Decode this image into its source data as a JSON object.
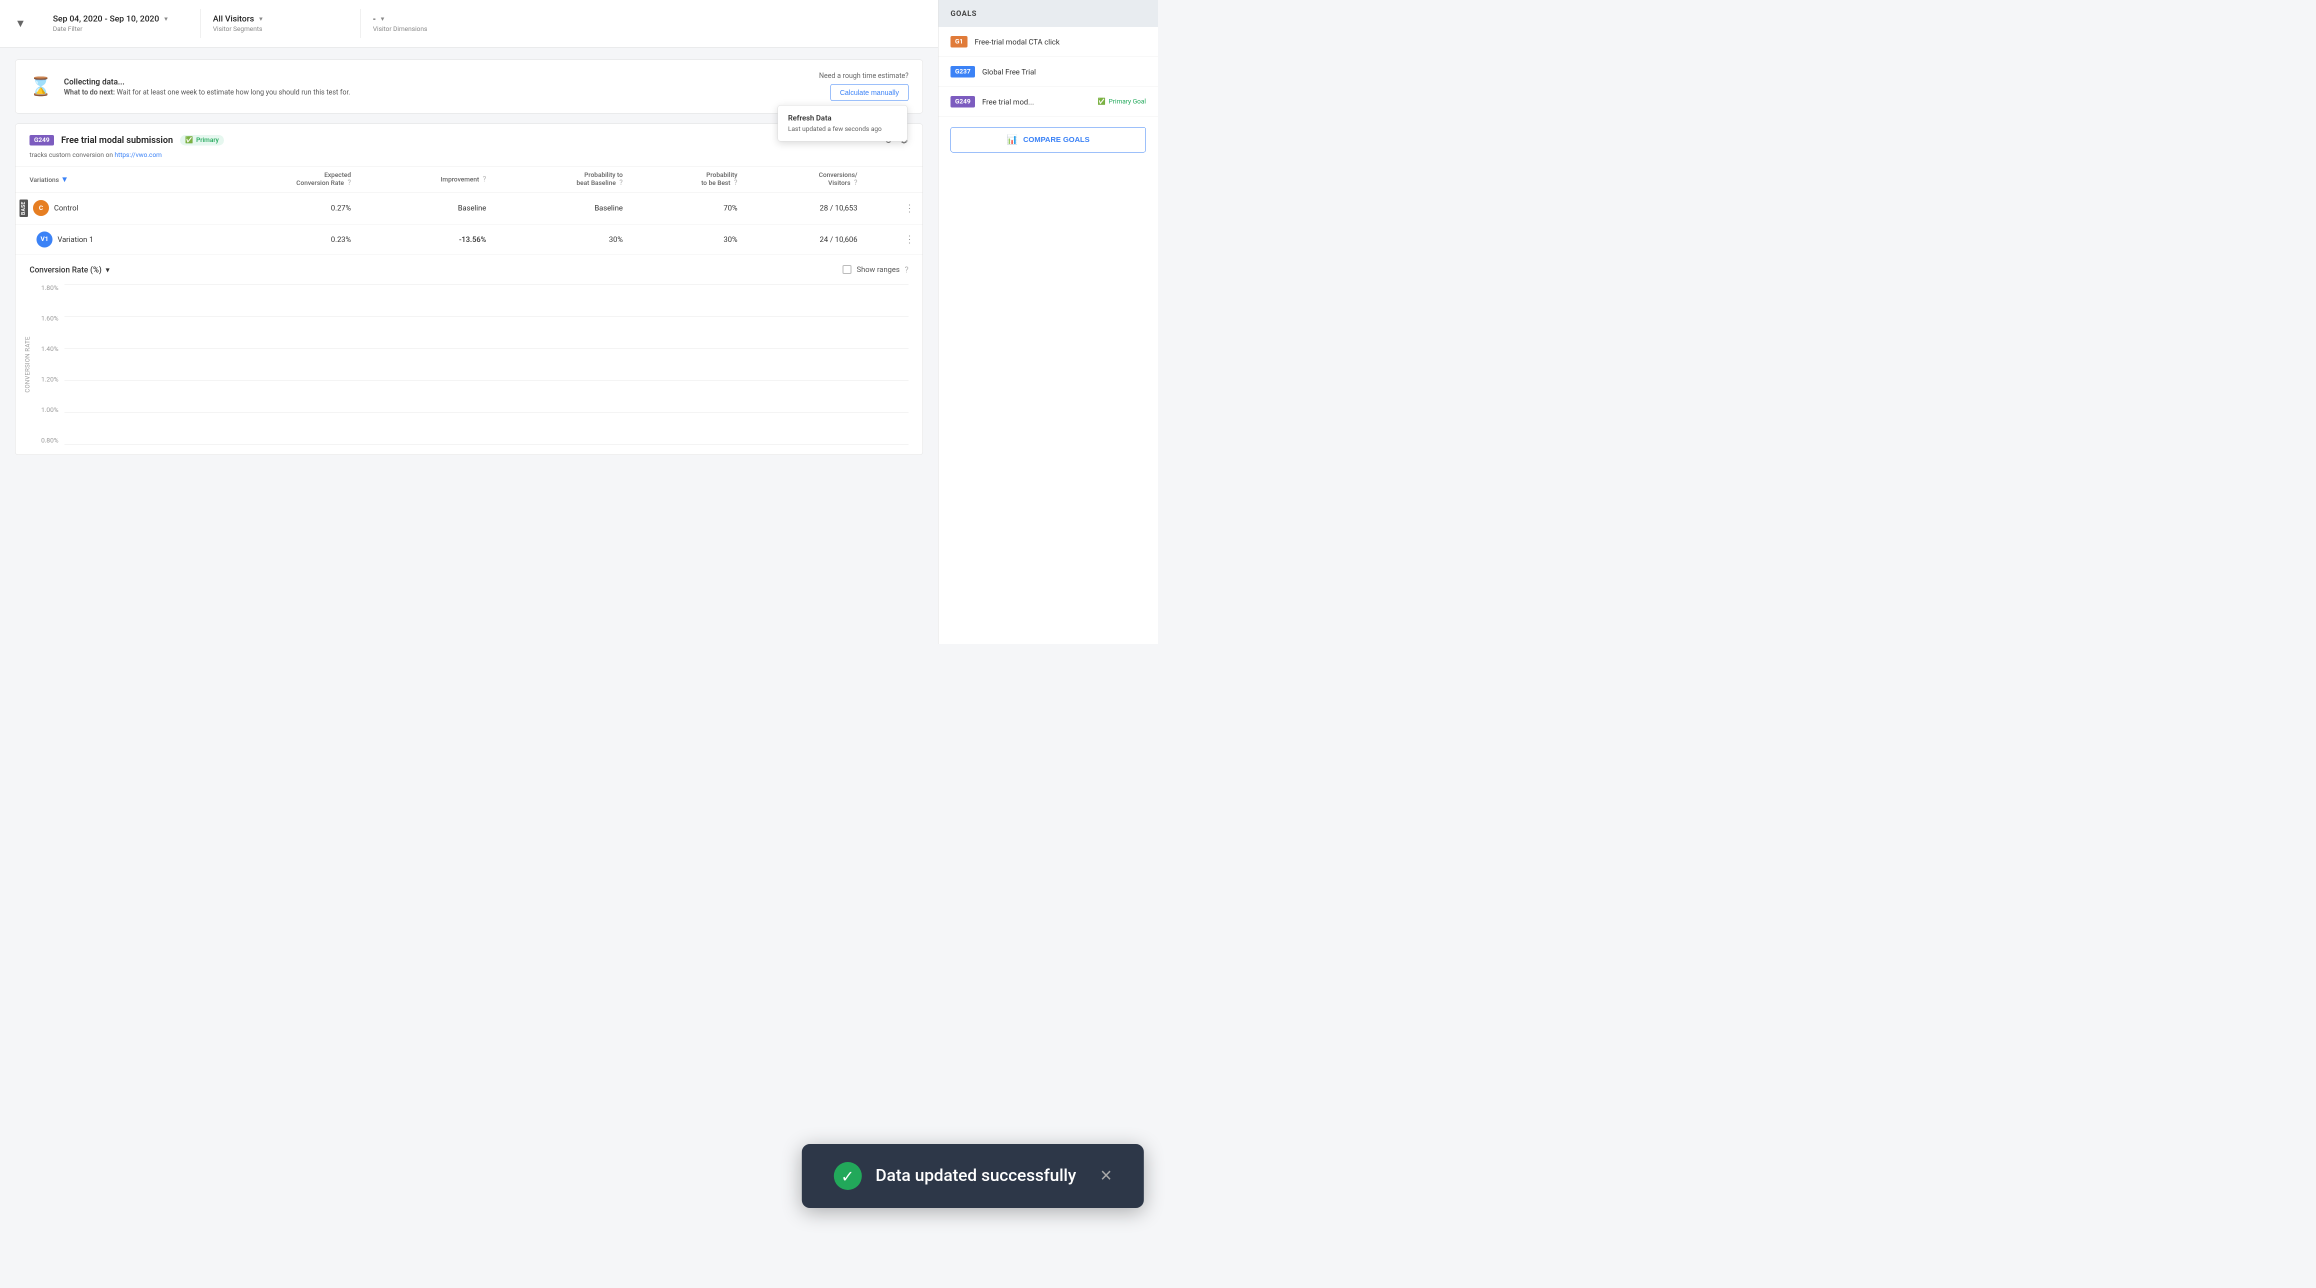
{
  "filter_bar": {
    "date_range": "Sep 04, 2020 - Sep 10, 2020",
    "date_label": "Date Filter",
    "segment": "All Visitors",
    "segment_label": "Visitor Segments",
    "dimension": "-",
    "dimension_label": "Visitor Dimensions"
  },
  "collecting_banner": {
    "title": "Collecting data...",
    "body_bold": "What to do next:",
    "body_text": " Wait for at least one week to estimate how long you should run this test for.",
    "estimate_text": "Need a rough time estimate?",
    "calculate_btn": "Calculate manually"
  },
  "refresh_popup": {
    "title": "Refresh Data",
    "subtitle": "Last updated a few seconds ago"
  },
  "goal_section": {
    "badge": "G249",
    "title": "Free trial modal submission",
    "primary_label": "Primary",
    "tracks_text": "tracks custom conversion on ",
    "tracks_link": "https://vwo.com",
    "table": {
      "headers": [
        "Variations",
        "Expected\nConversion Rate",
        "Improvement",
        "Probability to\nbeat Baseline",
        "Probability\nto be Best",
        "Conversions/\nVisitors"
      ],
      "rows": [
        {
          "base": true,
          "circle_label": "C",
          "circle_class": "circle-control",
          "name": "Control",
          "expected_cr": "0.27%",
          "improvement": "Baseline",
          "improvement_class": "",
          "prob_beat": "Baseline",
          "prob_best": "70%",
          "conversions": "28 / 10,653"
        },
        {
          "base": false,
          "circle_label": "V1",
          "circle_class": "circle-v1",
          "name": "Variation 1",
          "expected_cr": "0.23%",
          "improvement": "-13.56%",
          "improvement_class": "improvement-negative",
          "prob_beat": "30%",
          "prob_best": "30%",
          "conversions": "24 / 10,606"
        }
      ]
    }
  },
  "chart_section": {
    "dropdown_label": "Conversion Rate (%)",
    "show_ranges_label": "Show ranges",
    "y_axis_title": "CONVERSION RATE",
    "y_labels": [
      "1.80%",
      "1.60%",
      "1.40%",
      "1.20%",
      "1.00%",
      "0.80%"
    ]
  },
  "goals_sidebar": {
    "header": "GOALS",
    "items": [
      {
        "badge": "G1",
        "badge_class": "badge-g1",
        "name": "Free-trial modal CTA click",
        "primary": false
      },
      {
        "badge": "G237",
        "badge_class": "badge-g237",
        "name": "Global Free Trial",
        "primary": false
      },
      {
        "badge": "G249",
        "badge_class": "badge-g249",
        "name": "Free trial mod...",
        "primary": true,
        "primary_label": "Primary Goal"
      }
    ],
    "compare_btn": "COMPARE GOALS"
  },
  "toast": {
    "message": "Data updated successfully",
    "close": "×"
  },
  "detection": {
    "g237_label": "6237 Global Free Trial",
    "show_ranges": "Show ranges"
  }
}
